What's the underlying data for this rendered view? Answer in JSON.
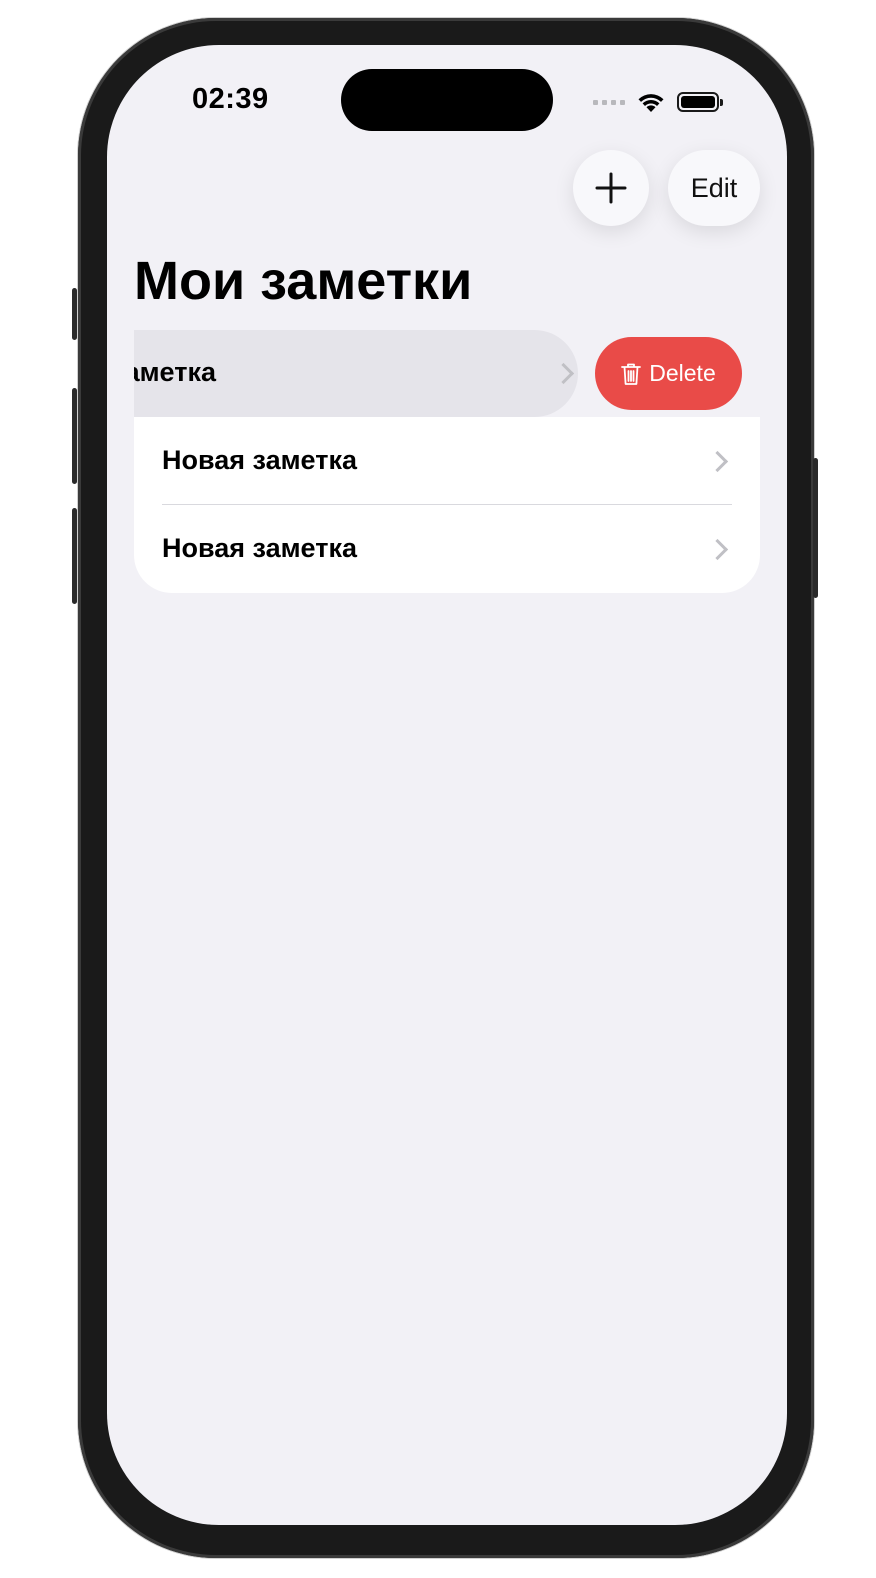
{
  "status_bar": {
    "time": "02:39"
  },
  "toolbar": {
    "add_icon": "plus-icon",
    "edit_label": "Edit"
  },
  "page": {
    "title": "Мои заметки"
  },
  "notes": {
    "items": [
      {
        "title": "Новая заметка",
        "swiped": true,
        "visible_text": "етка"
      },
      {
        "title": "Новая заметка",
        "swiped": false
      },
      {
        "title": "Новая заметка",
        "swiped": false
      }
    ],
    "delete_label": "Delete",
    "delete_icon": "trash-icon"
  },
  "colors": {
    "background": "#f2f1f6",
    "delete": "#e94b48",
    "card": "#ffffff",
    "swiped_row": "#e5e4ea"
  }
}
